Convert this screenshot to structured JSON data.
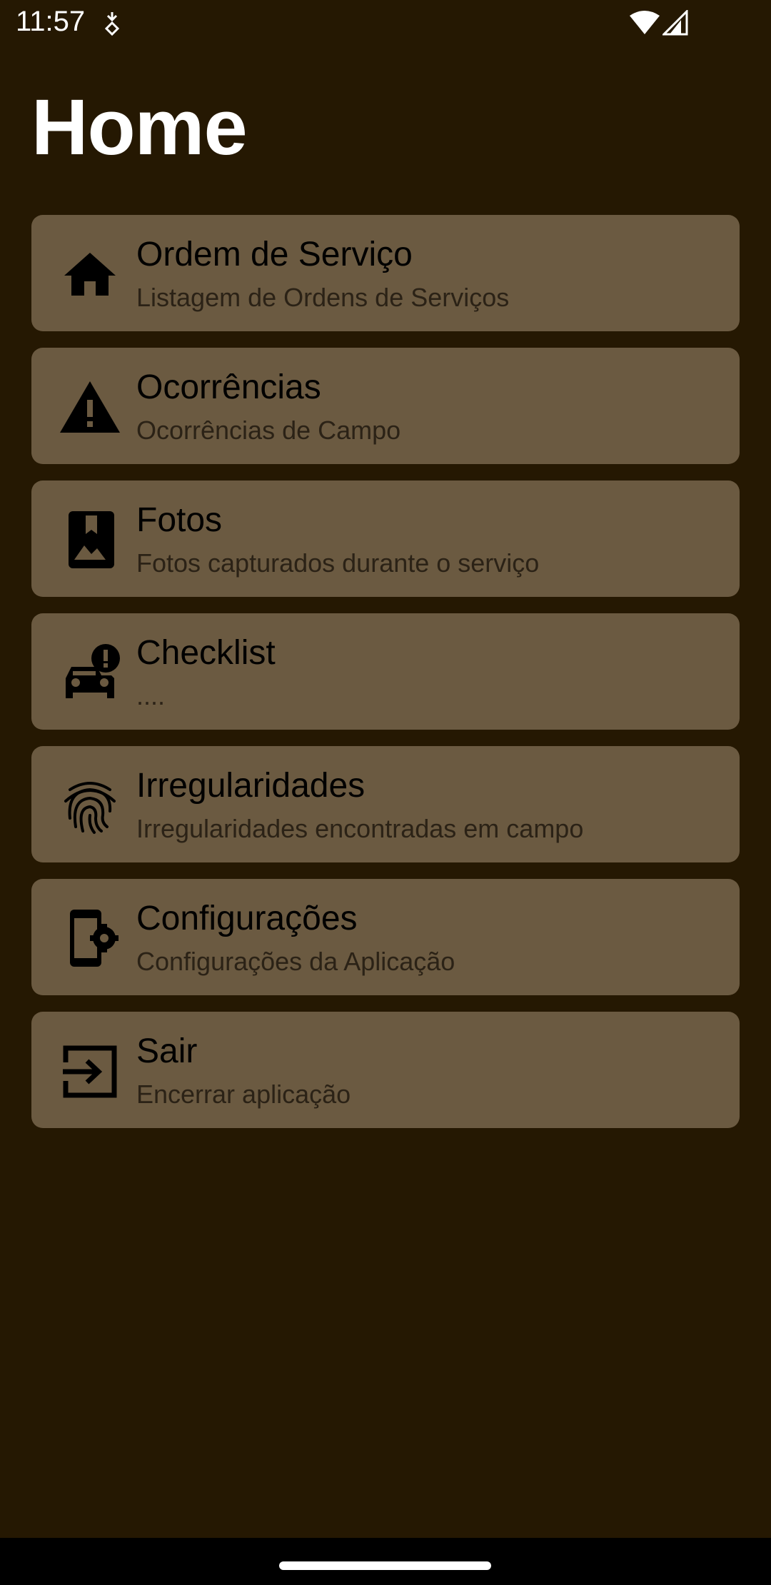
{
  "status_bar": {
    "time": "11:57",
    "notification_icon": "location-sync-icon",
    "wifi_icon": "wifi-icon",
    "signal_icon": "cell-signal-icon"
  },
  "header": {
    "title": "Home"
  },
  "colors": {
    "background": "#251802",
    "card": "#6b5a41",
    "title_text": "#ffffff",
    "item_title": "#000000",
    "item_subtitle": "#2b2216"
  },
  "menu": {
    "items": [
      {
        "icon": "home-icon",
        "title": "Ordem de Serviço",
        "subtitle": "Listagem de Ordens de Serviços"
      },
      {
        "icon": "warning-icon",
        "title": "Ocorrências",
        "subtitle": "Ocorrências de Campo"
      },
      {
        "icon": "photo-album-icon",
        "title": "Fotos",
        "subtitle": "Fotos capturados durante o serviço"
      },
      {
        "icon": "car-alert-icon",
        "title": "Checklist",
        "subtitle": "...."
      },
      {
        "icon": "fingerprint-icon",
        "title": "Irregularidades",
        "subtitle": "Irregularidades encontradas em campo"
      },
      {
        "icon": "phone-settings-icon",
        "title": "Configurações",
        "subtitle": "Configurações da Aplicação"
      },
      {
        "icon": "exit-icon",
        "title": "Sair",
        "subtitle": "Encerrar aplicação"
      }
    ]
  }
}
